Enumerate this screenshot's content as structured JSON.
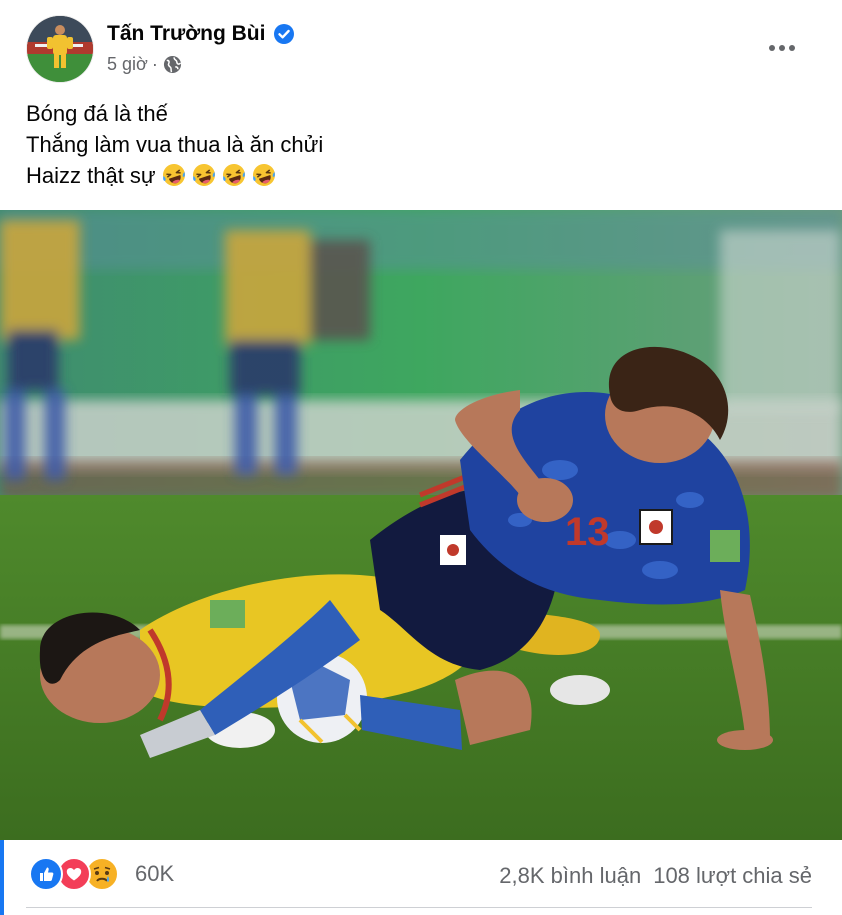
{
  "post": {
    "author": "Tấn Trường Bùi",
    "timestamp": "5 giờ",
    "separator": "·",
    "lines": [
      "Bóng đá là thế",
      "Thắng làm vua thua là ăn chửi",
      "Haizz thật sự"
    ],
    "emoji_count": 4
  },
  "reactions": {
    "types": [
      "like",
      "love",
      "sad"
    ],
    "count": "60K"
  },
  "stats": {
    "comments": "2,8K bình luận",
    "shares": "108 lượt chia sẻ"
  },
  "colors": {
    "accent": "#1877f2",
    "secondary_text": "#65676b",
    "love": "#f33e58",
    "sad": "#f7b125"
  },
  "icons": [
    "verified-badge-icon",
    "globe-icon",
    "more-options-icon",
    "laughing-emoji-icon"
  ]
}
